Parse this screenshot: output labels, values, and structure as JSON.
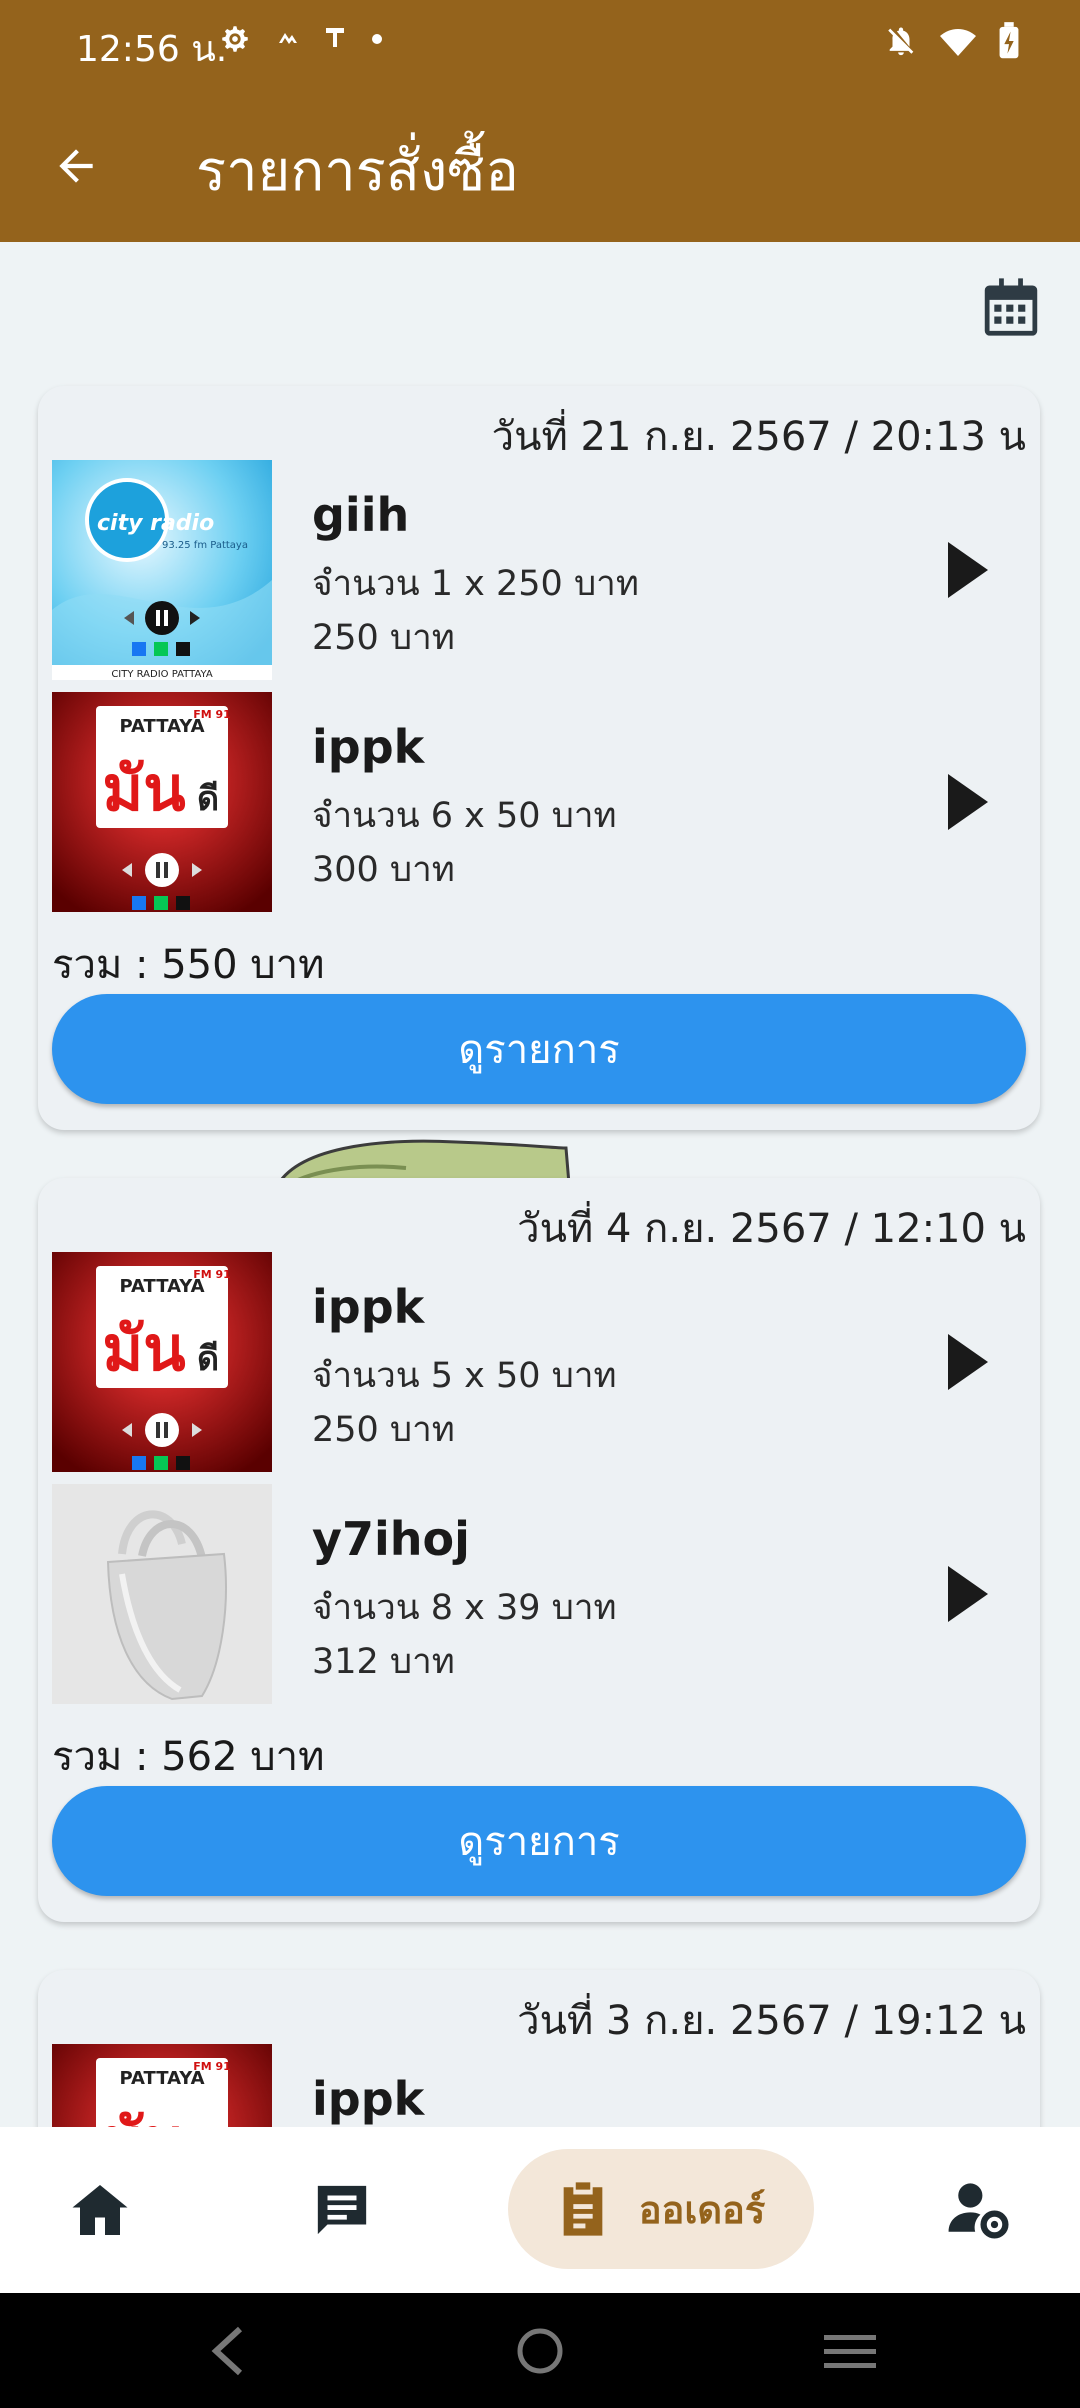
{
  "status_bar": {
    "time": "12:56 น."
  },
  "app_bar": {
    "title": "รายการสั่งซื้อ"
  },
  "orders": [
    {
      "date": "วันที่ 21 ก.ย. 2567 / 20:13 น",
      "items": [
        {
          "name": "giih",
          "qty": "จำนวน 1 x 250 บาท",
          "total": "250 บาท",
          "thumb": "city-radio"
        },
        {
          "name": "ippk",
          "qty": "จำนวน 6 x 50 บาท",
          "total": "300 บาท",
          "thumb": "pattaya-radio"
        }
      ],
      "sum": "รวม : 550 บาท",
      "button": "ดูรายการ"
    },
    {
      "date": "วันที่ 4 ก.ย. 2567 / 12:10 น",
      "items": [
        {
          "name": "ippk",
          "qty": "จำนวน 5 x 50 บาท",
          "total": "250 บาท",
          "thumb": "pattaya-radio"
        },
        {
          "name": "y7ihoj",
          "qty": "จำนวน 8 x 39 บาท",
          "total": "312 บาท",
          "thumb": "bag"
        }
      ],
      "sum": "รวม : 562 บาท",
      "button": "ดูรายการ"
    },
    {
      "date": "วันที่ 3 ก.ย. 2567 / 19:12 น",
      "items": [
        {
          "name": "ippk",
          "thumb": "pattaya-radio"
        }
      ]
    }
  ],
  "thumb_text": {
    "city_logo": "city radio",
    "city_sub": "93.25 fm Pattaya",
    "city_footer": "CITY RADIO PATTAYA",
    "pattaya_top": "PATTAYA",
    "pattaya_fm": "FM 91",
    "pattaya_main": "มัน",
    "pattaya_side": "ดี"
  },
  "bottom_nav": {
    "orders_label": "ออเดอร์",
    "items": [
      "home-icon",
      "chat-icon",
      "clipboard-icon",
      "user-settings-icon"
    ]
  },
  "colors": {
    "primary": "#94631c",
    "button": "#2d93ee",
    "nav_active_bg": "#f3e7d9"
  }
}
